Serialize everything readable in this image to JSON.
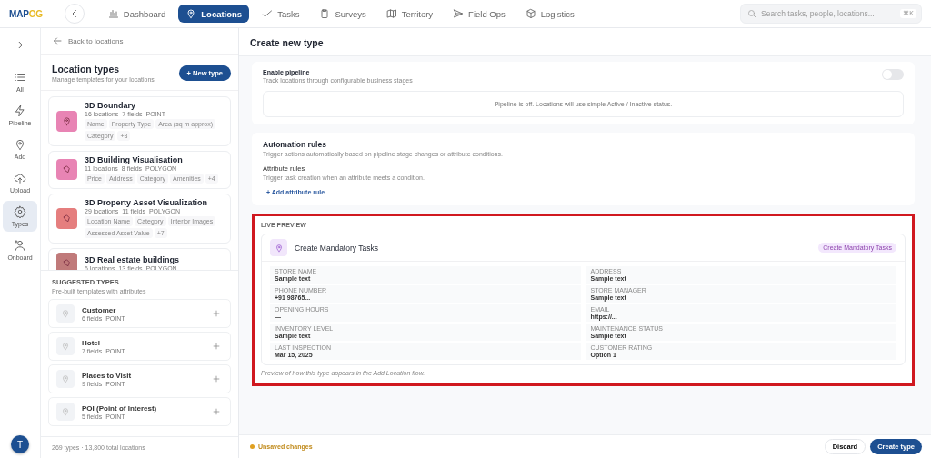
{
  "logo": {
    "part_1": "MAP",
    "part_2": "OG"
  },
  "nav_tabs": [
    {
      "label": "Dashboard",
      "kind": "chart",
      "selected": false
    },
    {
      "label": "Locations",
      "kind": "pin",
      "selected": true
    },
    {
      "label": "Tasks",
      "kind": "check",
      "selected": false
    },
    {
      "label": "Surveys",
      "kind": "clipboard",
      "selected": false
    },
    {
      "label": "Territory",
      "kind": "map",
      "selected": false
    },
    {
      "label": "Field Ops",
      "kind": "send",
      "selected": false
    },
    {
      "label": "Logistics",
      "kind": "box",
      "selected": false
    }
  ],
  "search": {
    "placeholder": "Search tasks, people, locations...",
    "shortcut": "⌘K"
  },
  "rail": {
    "items": [
      {
        "label": "All",
        "kind": "list",
        "selected": false
      },
      {
        "label": "Pipeline",
        "kind": "bolt",
        "selected": false
      },
      {
        "label": "Add",
        "kind": "pin",
        "selected": false
      },
      {
        "label": "Upload",
        "kind": "cloud",
        "selected": false
      },
      {
        "label": "Types",
        "kind": "gear",
        "selected": true
      },
      {
        "label": "Onboard",
        "kind": "user",
        "selected": false
      }
    ],
    "avatar": "T"
  },
  "left_panel": {
    "back_link": "Back to locations",
    "title": "Location types",
    "subtitle": "Manage templates for your locations",
    "new_button": "+ New type",
    "types": [
      {
        "name": "3D Boundary",
        "locations": "16 locations",
        "fields": "7 fields",
        "geometry": "POINT",
        "kind": "point",
        "color": "#e884b4",
        "chips": [
          "Name",
          "Property Type",
          "Area (sq m approx)",
          "Category",
          "+3"
        ]
      },
      {
        "name": "3D Building Visualisation",
        "locations": "11 locations",
        "fields": "8 fields",
        "geometry": "POLYGON",
        "kind": "polygon",
        "color": "#e884b4",
        "chips": [
          "Price",
          "Address",
          "Category",
          "Amenities",
          "+4"
        ]
      },
      {
        "name": "3D Property Asset Visualization",
        "locations": "29 locations",
        "fields": "11 fields",
        "geometry": "POLYGON",
        "kind": "polygon",
        "color": "#e57e7e",
        "chips": [
          "Location Name",
          "Category",
          "Interior Images",
          "Assessed Asset Value",
          "+7"
        ]
      },
      {
        "name": "3D Real estate buildings",
        "locations": "6 locations",
        "fields": "13 fields",
        "geometry": "POLYGON",
        "kind": "polygon",
        "color": "#c07a7a"
      }
    ],
    "suggested_title": "SUGGESTED TYPES",
    "suggested_subtitle": "Pre-built templates with attributes",
    "suggested": [
      {
        "name": "Customer",
        "fields": "6 fields",
        "geometry": "POINT"
      },
      {
        "name": "Hotel",
        "fields": "7 fields",
        "geometry": "POINT"
      },
      {
        "name": "Places to Visit",
        "fields": "9 fields",
        "geometry": "POINT"
      },
      {
        "name": "POI (Point of Interest)",
        "fields": "5 fields",
        "geometry": "POINT"
      }
    ],
    "footer": "269 types · 13,800 total locations"
  },
  "main": {
    "title": "Create new type",
    "pipeline": {
      "title": "Enable pipeline",
      "subtitle": "Track locations through configurable business stages",
      "on": false,
      "note": "Pipeline is off. Locations will use simple Active / Inactive status."
    },
    "automation": {
      "title": "Automation rules",
      "subtitle": "Trigger actions automatically based on pipeline stage changes or attribute conditions.",
      "section_title": "Attribute rules",
      "section_subtitle": "Trigger task creation when an attribute meets a condition.",
      "add_link": "+ Add attribute rule"
    },
    "preview": {
      "heading": "LIVE PREVIEW",
      "name": "Create Mandatory Tasks",
      "badge": "Create Mandatory Tasks",
      "fields": [
        {
          "label": "STORE NAME",
          "value": "Sample text"
        },
        {
          "label": "ADDRESS",
          "value": "Sample text"
        },
        {
          "label": "PHONE NUMBER",
          "value": "+91 98765..."
        },
        {
          "label": "STORE MANAGER",
          "value": "Sample text"
        },
        {
          "label": "OPENING HOURS",
          "value": "—"
        },
        {
          "label": "EMAIL",
          "value": "https://..."
        },
        {
          "label": "INVENTORY LEVEL",
          "value": "Sample text"
        },
        {
          "label": "MAINTENANCE STATUS",
          "value": "Sample text"
        },
        {
          "label": "LAST INSPECTION",
          "value": "Mar 15, 2025"
        },
        {
          "label": "CUSTOMER RATING",
          "value": "Option 1"
        }
      ],
      "caption": "Preview of how this type appears in the Add Location flow."
    },
    "footer": {
      "status": "Unsaved changes",
      "discard": "Discard",
      "create": "Create type"
    }
  }
}
